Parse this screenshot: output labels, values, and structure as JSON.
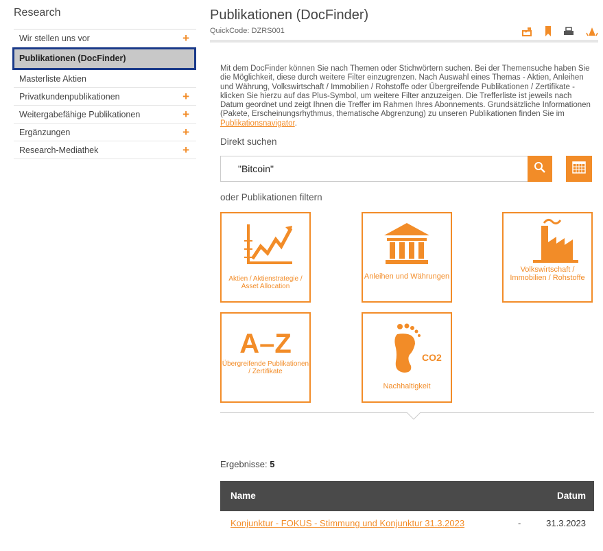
{
  "sidebar": {
    "title": "Research",
    "items": [
      {
        "label": "Wir stellen uns vor",
        "plus": "+"
      },
      {
        "label": "Publikationen (DocFinder)",
        "plus": ""
      },
      {
        "label": "Masterliste Aktien",
        "plus": ""
      },
      {
        "label": "Privatkundenpublikationen",
        "plus": "+"
      },
      {
        "label": "Weitergabefähige Publikationen",
        "plus": "+"
      },
      {
        "label": "Ergänzungen",
        "plus": "+"
      },
      {
        "label": "Research-Mediathek",
        "plus": "+"
      }
    ]
  },
  "main": {
    "title": "Publikationen (DocFinder)",
    "quickcode": "QuickCode: DZRS001",
    "intro": "Mit dem DocFinder können Sie nach Themen oder Stichwörtern suchen. Bei der Themensuche haben Sie die Möglichkeit, diese durch weitere Filter einzugrenzen. Nach Auswahl eines Themas - Aktien, Anleihen und Währung, Volkswirtschaft / Immobilien / Rohstoffe oder Übergreifende Publikationen / Zertifikate -klicken Sie hierzu auf das Plus-Symbol, um weitere Filter anzuzeigen. Die Trefferliste ist jeweils nach Datum geordnet und zeigt Ihnen die Treffer im Rahmen Ihres Abonnements. Grundsätzliche Informationen (Pakete, Erscheinungsrhythmus, thematische Abgrenzung) zu unseren Publikationen finden Sie im",
    "intro_link": "Publikationsnavigator",
    "intro_end": ".",
    "direct_label": "Direkt suchen",
    "search_value": "\"Bitcoin\"",
    "filter_label": "oder Publikationen filtern",
    "tiles": {
      "aktien": "Aktien / Aktienstrategie / Asset Allocation",
      "anleihen": "Anleihen und Währungen",
      "volks": "Volkswirtschaft / Immobilien / Rohstoffe",
      "az_letters": "A–Z",
      "az": "Übergreifende Publikationen / Zertifikate",
      "co2": "CO2",
      "nachhaltig": "Nachhaltigkeit"
    },
    "results_label": "Ergebnisse:",
    "results_count": "5",
    "table": {
      "col_name": "Name",
      "col_date": "Datum",
      "rows": [
        {
          "name": "Konjunktur - FOKUS - Stimmung und Konjunktur 31.3.2023",
          "dash": "-",
          "date": "31.3.2023"
        }
      ]
    }
  },
  "colors": {
    "accent": "#f28c28",
    "header_dark": "#4a4a4a",
    "active_border": "#1a3a8a"
  },
  "icons": [
    "share-icon",
    "bookmark-icon",
    "print-icon",
    "font-size-icon",
    "search-icon",
    "calendar-icon",
    "chart-icon",
    "bank-icon",
    "factory-icon",
    "footprint-icon"
  ]
}
